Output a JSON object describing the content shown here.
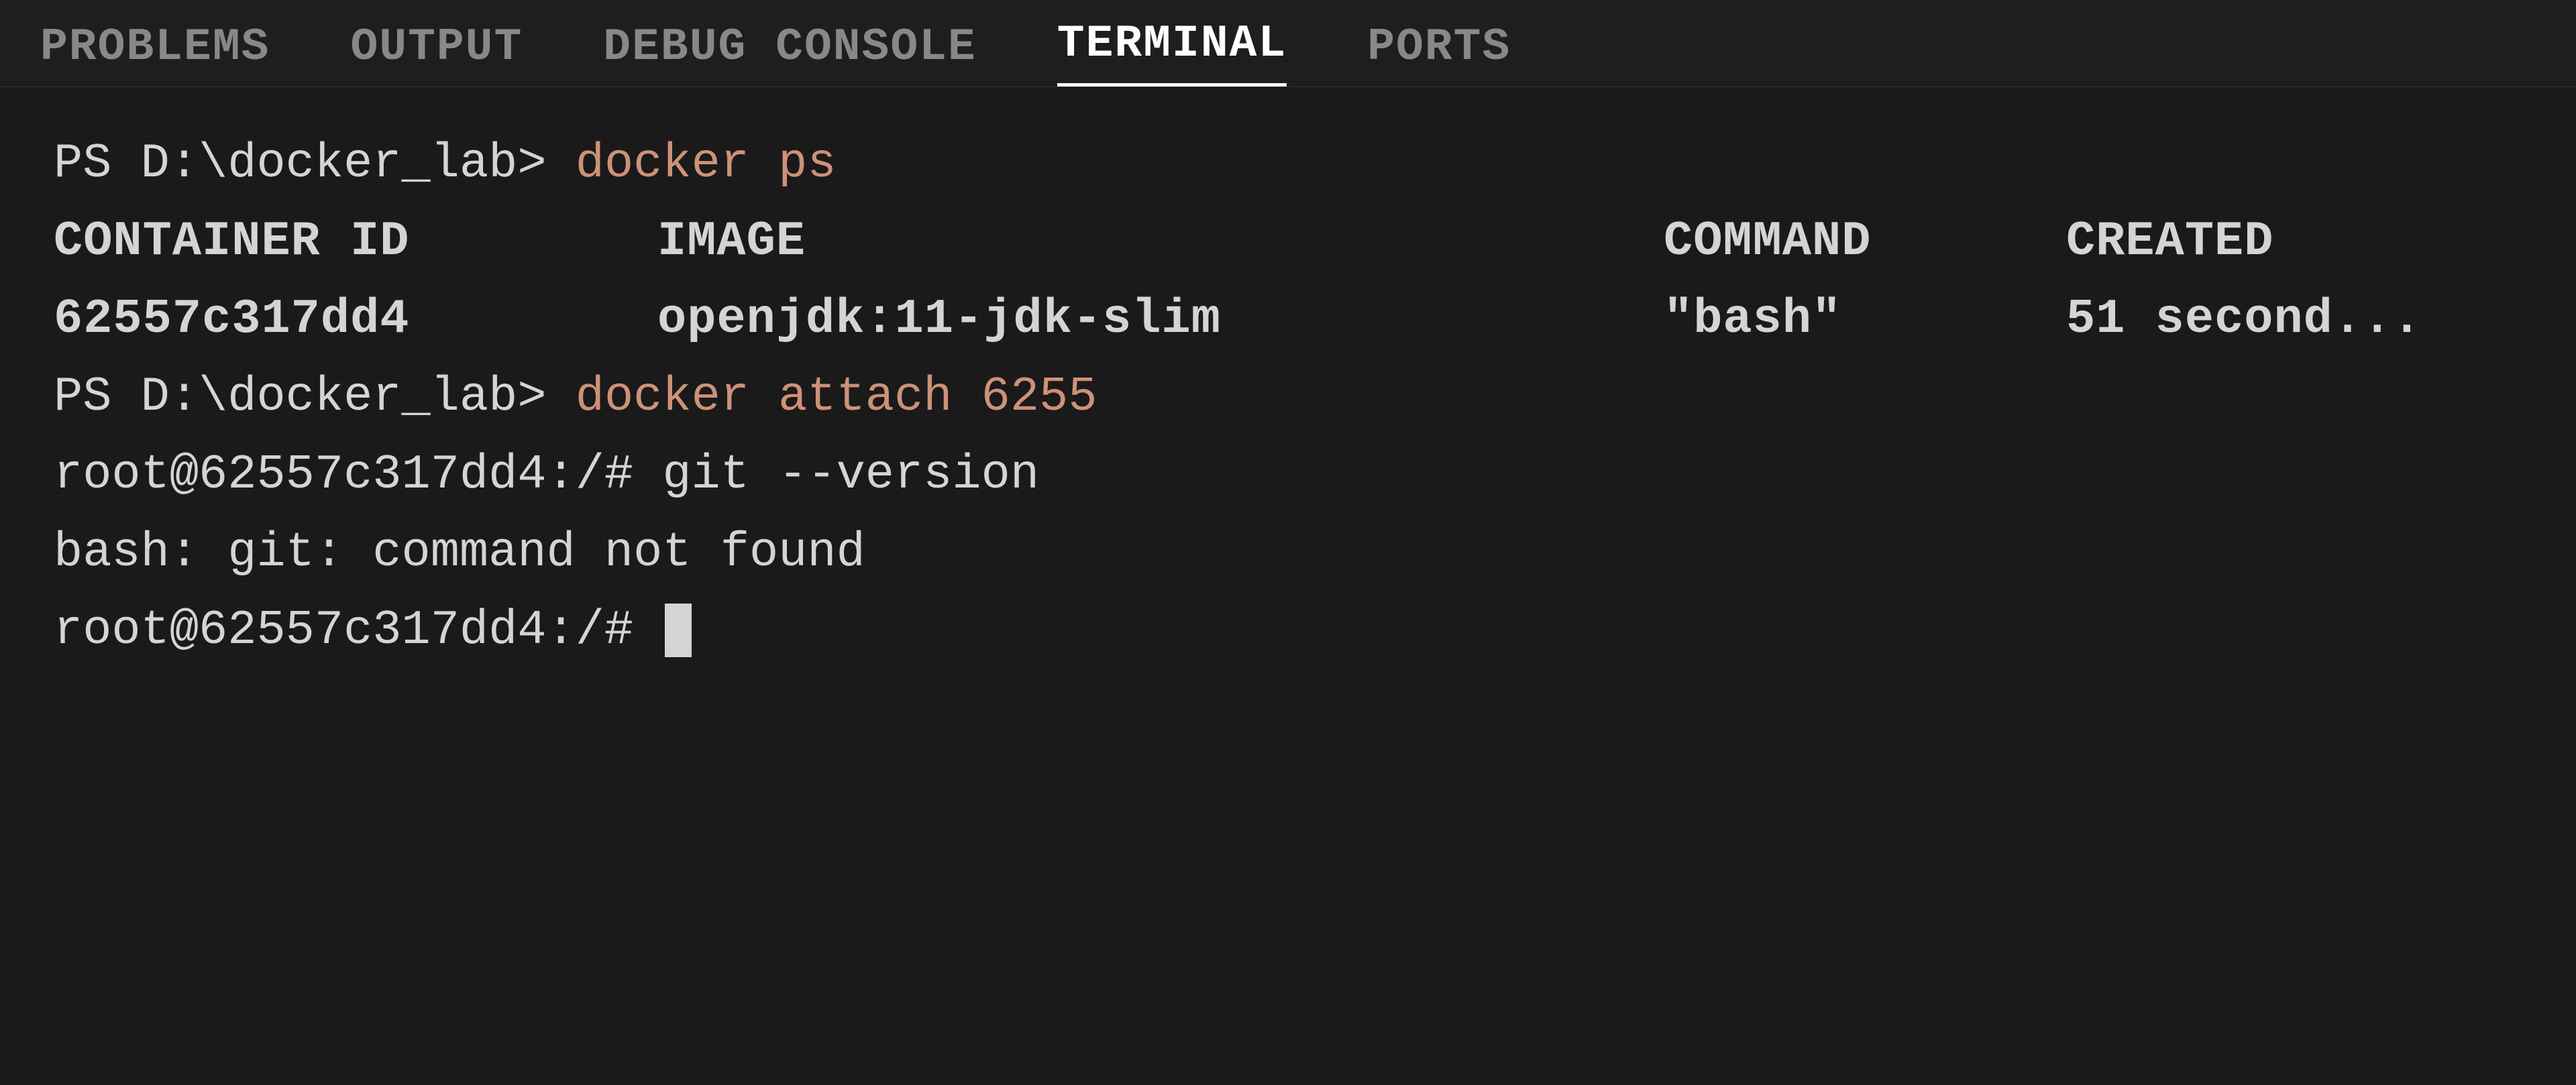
{
  "tabs": [
    {
      "id": "problems",
      "label": "PROBLEMS",
      "active": false
    },
    {
      "id": "output",
      "label": "OUTPUT",
      "active": false
    },
    {
      "id": "debug-console",
      "label": "DEBUG CONSOLE",
      "active": false
    },
    {
      "id": "terminal",
      "label": "TERMINAL",
      "active": true
    },
    {
      "id": "ports",
      "label": "PORTS",
      "active": false
    }
  ],
  "terminal": {
    "lines": [
      {
        "id": "line1",
        "type": "prompt",
        "prefix": "PS D:\\docker_lab> ",
        "command": "docker ps"
      },
      {
        "id": "line2",
        "type": "table-header",
        "columns": [
          "CONTAINER ID",
          "IMAGE",
          "COMMAND",
          "CREATED"
        ]
      },
      {
        "id": "line3",
        "type": "table-row",
        "values": [
          "62557c317dd4",
          "openjdk:11-jdk-slim",
          "\"bash\"",
          "51 second..."
        ]
      },
      {
        "id": "line4",
        "type": "prompt",
        "prefix": "PS D:\\docker_lab> ",
        "command": "docker attach 6255"
      },
      {
        "id": "line5",
        "type": "output",
        "text": "root@62557c317dd4:/# git --version"
      },
      {
        "id": "line6",
        "type": "output",
        "text": "bash: git: command not found"
      },
      {
        "id": "line7",
        "type": "prompt-cursor",
        "text": "root@62557c317dd4:/# "
      }
    ]
  }
}
